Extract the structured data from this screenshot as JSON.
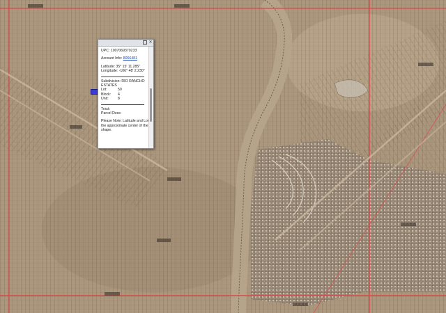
{
  "popup": {
    "upc": "UPC: 1007069370233",
    "account_label": "Account Info:",
    "account_link": "8066481",
    "latitude": "Latitude: 35° 15' 11.285\"",
    "longitude": "Longitude: -106° 48' 2.230\"",
    "subdivision_line1": "Subdivision: RIO RANCHO",
    "subdivision_line2": "ESTATES",
    "lot_label": "Lot:",
    "lot_value": "50",
    "block_label": "Block:",
    "block_value": "4",
    "unit_label": "Unit:",
    "unit_value": "8",
    "tract_label": "Tract:",
    "parcel_desc_label": "Parcel Desc:",
    "note_line1": "Please Note: Latitude and Longitude is",
    "note_line2": "the approximate center of the parcel",
    "note_line3": "shape."
  },
  "colors": {
    "terrain": "#a8957a",
    "parcel_lines": "#5a4a3a",
    "major_roads": "#d84a4a",
    "marker": "#3b3bd6"
  },
  "icons": [
    "maximize-icon",
    "close-icon"
  ]
}
